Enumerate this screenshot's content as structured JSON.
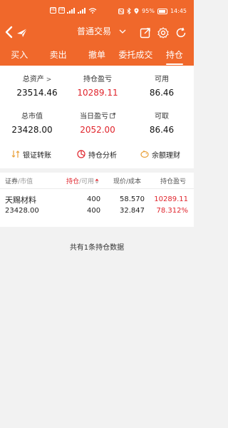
{
  "status_bar": {
    "network_chips": [
      "HD",
      "HD"
    ],
    "battery": "95%",
    "time": "14:45"
  },
  "title_bar": {
    "title": "普通交易"
  },
  "tabs": [
    {
      "label": "买入"
    },
    {
      "label": "卖出"
    },
    {
      "label": "撤单"
    },
    {
      "label": "委托成交"
    },
    {
      "label": "持仓"
    }
  ],
  "active_tab": "持仓",
  "summary": {
    "total_assets": {
      "label": "总资产",
      "value": "23514.46"
    },
    "position_pnl": {
      "label": "持仓盈亏",
      "value": "10289.11"
    },
    "available": {
      "label": "可用",
      "value": "86.46"
    },
    "market_value": {
      "label": "总市值",
      "value": "23428.00"
    },
    "daily_pnl": {
      "label": "当日盈亏",
      "value": "2052.00"
    },
    "withdrawable": {
      "label": "可取",
      "value": "86.46"
    }
  },
  "actions": [
    {
      "label": "银证转账",
      "icon": "transfer-icon"
    },
    {
      "label": "持仓分析",
      "icon": "pie-chart-icon"
    },
    {
      "label": "余额理财",
      "icon": "piggy-bank-icon"
    }
  ],
  "table": {
    "headers": {
      "security": "证券",
      "security_sub": "/市值",
      "holding": "持仓",
      "holding_sub": "/可用",
      "price": "现价/成本",
      "pnl": "持仓盈亏"
    },
    "rows": [
      {
        "name": "天赐材料",
        "market_value": "23428.00",
        "holding": "400",
        "available": "400",
        "price": "58.570",
        "cost": "32.847",
        "pnl": "10289.11",
        "pnl_pct": "78.312%"
      }
    ]
  },
  "footer_note": "共有1条持仓数据",
  "colors": {
    "brand": "#f0682b",
    "profit": "#e0242c"
  }
}
